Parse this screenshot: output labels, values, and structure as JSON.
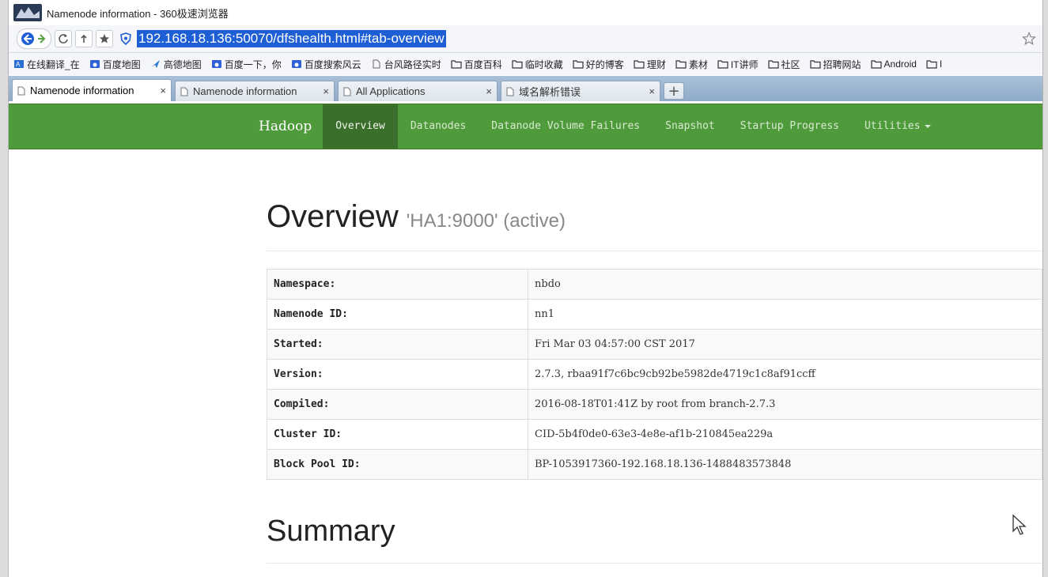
{
  "window": {
    "title": "Namenode information - 360极速浏览器"
  },
  "address_bar": {
    "url": "192.168.18.136:50070/dfshealth.html#tab-overview"
  },
  "bookmarks": [
    {
      "label": "在线翻译_在",
      "icon": "translate-icon"
    },
    {
      "label": "百度地图",
      "icon": "baidu-paw-icon"
    },
    {
      "label": "高德地图",
      "icon": "amap-icon"
    },
    {
      "label": "百度一下，你",
      "icon": "baidu-paw-icon"
    },
    {
      "label": "百度搜索风云",
      "icon": "baidu-paw-icon"
    },
    {
      "label": "台风路径实时",
      "icon": "page-icon"
    },
    {
      "label": "百度百科",
      "icon": "folder-icon"
    },
    {
      "label": "临时收藏",
      "icon": "folder-icon"
    },
    {
      "label": "好的博客",
      "icon": "folder-icon"
    },
    {
      "label": "理财",
      "icon": "folder-icon"
    },
    {
      "label": "素材",
      "icon": "folder-icon"
    },
    {
      "label": "IT讲师",
      "icon": "folder-icon"
    },
    {
      "label": "社区",
      "icon": "folder-icon"
    },
    {
      "label": "招聘网站",
      "icon": "folder-icon"
    },
    {
      "label": "Android",
      "icon": "folder-icon"
    },
    {
      "label": "I",
      "icon": "folder-icon"
    }
  ],
  "tabs": [
    {
      "label": "Namenode information",
      "close": "×"
    },
    {
      "label": "Namenode information",
      "close": "×"
    },
    {
      "label": "All Applications",
      "close": "×"
    },
    {
      "label": "域名解析错误",
      "close": "×"
    }
  ],
  "new_tab": "+",
  "hadoop_nav": {
    "brand": "Hadoop",
    "items": [
      "Overview",
      "Datanodes",
      "Datanode Volume Failures",
      "Snapshot",
      "Startup Progress",
      "Utilities"
    ]
  },
  "overview": {
    "title": "Overview",
    "subtitle": "'HA1:9000' (active)",
    "rows": [
      {
        "key": "Namespace:",
        "value": "nbdo"
      },
      {
        "key": "Namenode ID:",
        "value": "nn1"
      },
      {
        "key": "Started:",
        "value": "Fri Mar 03 04:57:00 CST 2017"
      },
      {
        "key": "Version:",
        "value": "2.7.3, rbaa91f7c6bc9cb92be5982de4719c1c8af91ccff"
      },
      {
        "key": "Compiled:",
        "value": "2016-08-18T01:41Z by root from branch-2.7.3"
      },
      {
        "key": "Cluster ID:",
        "value": "CID-5b4f0de0-63e3-4e8e-af1b-210845ea229a"
      },
      {
        "key": "Block Pool ID:",
        "value": "BP-1053917360-192.168.18.136-1488483573848"
      }
    ]
  },
  "summary": {
    "title": "Summary"
  },
  "colors": {
    "hadoop_green": "#4f9a3a",
    "nav_active": "#3a6f2b",
    "url_highlight": "#1f5fd6"
  }
}
